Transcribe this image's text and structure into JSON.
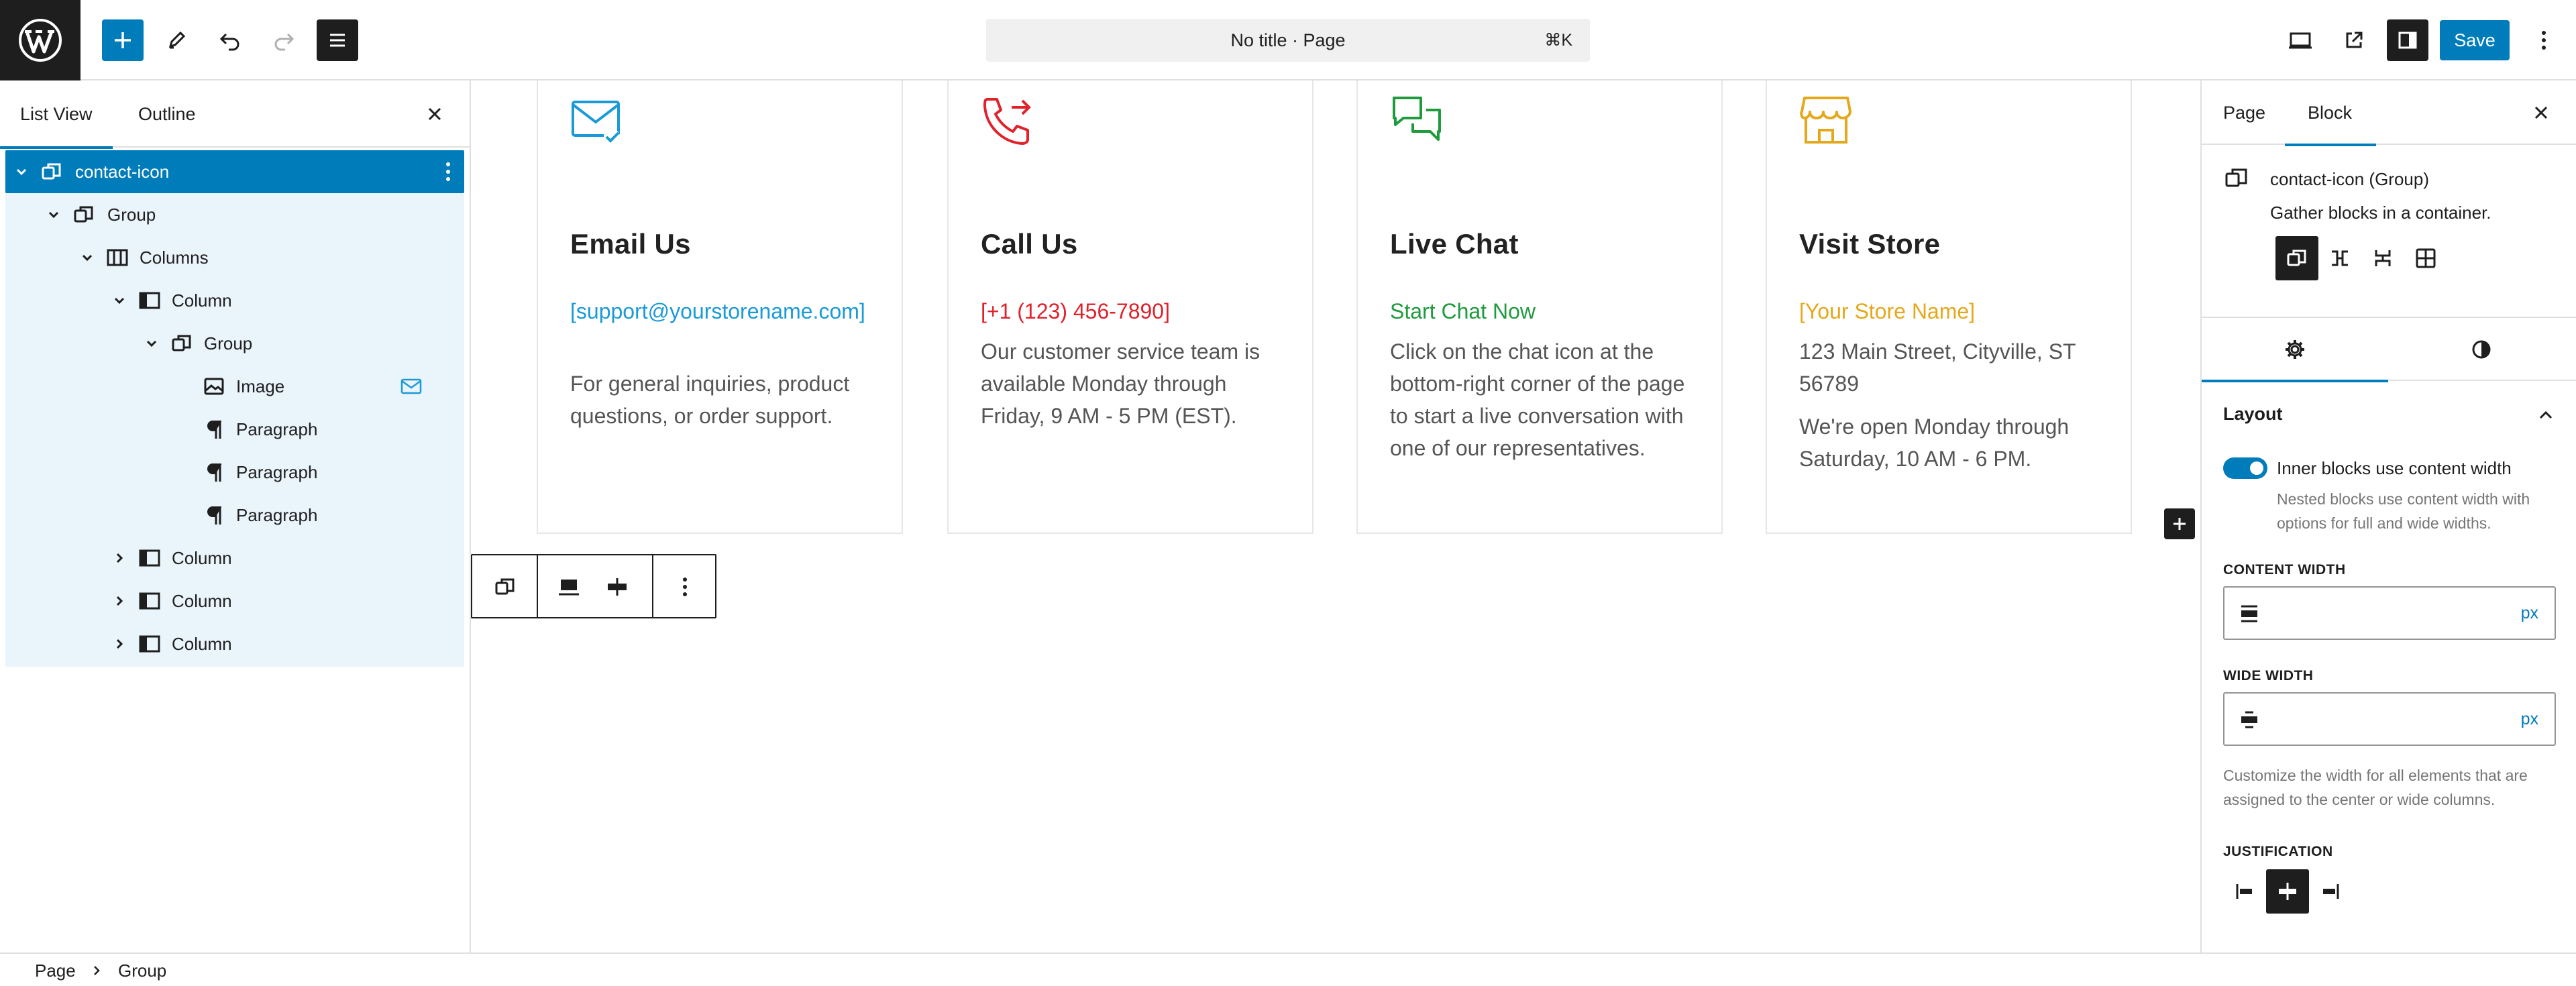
{
  "topbar": {
    "command_title": "No title · Page",
    "command_shortcut": "⌘K",
    "save_label": "Save",
    "accent_color": "#007cba"
  },
  "list_view": {
    "tab_list": "List View",
    "tab_outline": "Outline",
    "items": [
      {
        "label": "contact-icon",
        "icon": "group-icon",
        "selected": true
      },
      {
        "label": "Group",
        "icon": "group-icon"
      },
      {
        "label": "Columns",
        "icon": "columns-icon"
      },
      {
        "label": "Column",
        "icon": "column-icon"
      },
      {
        "label": "Group",
        "icon": "group-icon"
      },
      {
        "label": "Image",
        "icon": "image-icon"
      },
      {
        "label": "Paragraph",
        "icon": "paragraph-icon"
      },
      {
        "label": "Paragraph",
        "icon": "paragraph-icon"
      },
      {
        "label": "Paragraph",
        "icon": "paragraph-icon"
      },
      {
        "label": "Column",
        "icon": "column-icon"
      },
      {
        "label": "Column",
        "icon": "column-icon"
      },
      {
        "label": "Column",
        "icon": "column-icon"
      }
    ]
  },
  "canvas": {
    "cards": [
      {
        "icon": "mail-check-icon",
        "color": "#1a9ad6",
        "heading": "Email Us",
        "highlight": "[support@yourstorename.com]",
        "body": "For general inquiries, product questions, or order support."
      },
      {
        "icon": "phone-forward-icon",
        "color": "#e0222b",
        "heading": "Call Us",
        "highlight": "[+1 (123) 456-7890]",
        "body": "Our customer service team is available Monday through Friday, 9 AM - 5 PM (EST)."
      },
      {
        "icon": "chat-bubbles-icon",
        "color": "#1f9a3d",
        "heading": "Live Chat",
        "highlight": "Start Chat Now",
        "body": "Click on the chat icon at the bottom-right corner of the page to start a live conversation with one of our representatives."
      },
      {
        "icon": "store-icon",
        "color": "#e4a81a",
        "heading": "Visit Store",
        "highlight": "[Your Store Name]",
        "body": "123 Main Street, Cityville, ST 56789",
        "body2": "We're open Monday through Saturday, 10 AM - 6 PM."
      }
    ]
  },
  "settings": {
    "tab_page": "Page",
    "tab_block": "Block",
    "block_title": "contact-icon (Group)",
    "block_description": "Gather blocks in a container.",
    "layout_heading": "Layout",
    "toggle_label": "Inner blocks use content width",
    "toggle_on": true,
    "toggle_help": "Nested blocks use content width with options for full and wide widths.",
    "content_width_label": "CONTENT WIDTH",
    "content_width_value": "",
    "content_width_unit": "px",
    "wide_width_label": "WIDE WIDTH",
    "wide_width_value": "",
    "wide_width_unit": "px",
    "width_help": "Customize the width for all elements that are assigned to the center or wide columns.",
    "justification_label": "JUSTIFICATION",
    "justification_selected": "center"
  },
  "breadcrumb": [
    "Page",
    "Group"
  ]
}
